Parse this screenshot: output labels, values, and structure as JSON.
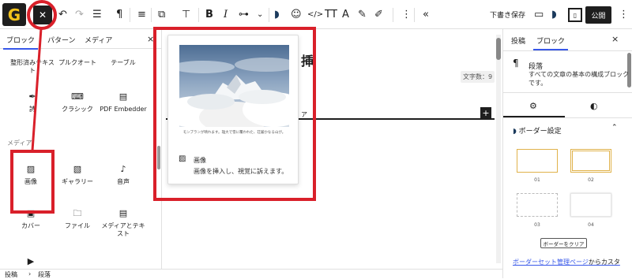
{
  "toolbar": {
    "logo": "G",
    "close": "✕",
    "save_draft": "下書き保存",
    "publish": "公開",
    "icons": [
      "undo-icon",
      "redo-icon",
      "list-view-icon",
      "paragraph-icon",
      "align-icon",
      "reusable-icon",
      "paint-icon",
      "bold-icon",
      "italic-icon",
      "link-icon",
      "chevron-down-icon",
      "wave-icon",
      "emoji-icon",
      "code-icon",
      "text-size-icon",
      "font-icon",
      "highlighter-icon",
      "pen-icon",
      "more-icon",
      "collapse-icon",
      "desktop-view-icon",
      "theme-icon",
      "sidebar-toggle-icon",
      "more-options-icon"
    ]
  },
  "left_panel": {
    "tabs": [
      "ブロック",
      "パターン",
      "メディア"
    ],
    "active_tab": "ブロック",
    "close": "×",
    "category_media": "メディア",
    "blocks": [
      {
        "label": "整形済みテキスト",
        "icon": "¶"
      },
      {
        "label": "プルクオート",
        "icon": "❝"
      },
      {
        "label": "テーブル",
        "icon": "▦"
      },
      {
        "label": "詩",
        "icon": "✒"
      },
      {
        "label": "クラシック",
        "icon": "⌨"
      },
      {
        "label": "PDF Embedder",
        "icon": "▤"
      },
      {
        "label": "画像",
        "icon": "🖼"
      },
      {
        "label": "ギャラリー",
        "icon": "▧"
      },
      {
        "label": "音声",
        "icon": "♪"
      },
      {
        "label": "カバー",
        "icon": "▣"
      },
      {
        "label": "ファイル",
        "icon": "🗀"
      },
      {
        "label": "メディアとテキスト",
        "icon": "▤"
      },
      {
        "label": "",
        "icon": "▶"
      }
    ]
  },
  "canvas": {
    "title_char": "挿",
    "side_char": "ア",
    "word_count": "文字数：9",
    "add_block": "+"
  },
  "popup": {
    "caption": "モンブランが晴れます。雄大で雪に覆われた、荘厳かなる山が。",
    "title": "画像",
    "description": "画像を挿入し、視覚に訴えます。"
  },
  "right_panel": {
    "tabs": [
      "投稿",
      "ブロック"
    ],
    "active_tab": "ブロック",
    "close": "×",
    "block_icon": "¶",
    "block_name": "段落",
    "block_description": "すべての文章の基本の構成ブロックです。",
    "settings_tabs": [
      "settings-gear-icon",
      "styles-contrast-icon"
    ],
    "section_title": "ボーダー設定",
    "border_options": [
      "01",
      "02",
      "03",
      "04"
    ],
    "clear_button": "ボーダーをクリア",
    "link_text": "ボーダーセット管理ページ",
    "link_rest": "からカスタ"
  },
  "footer": {
    "breadcrumb": [
      "投稿",
      "段落"
    ],
    "separator": "›"
  },
  "annotations": {
    "color": "#d9202a"
  }
}
